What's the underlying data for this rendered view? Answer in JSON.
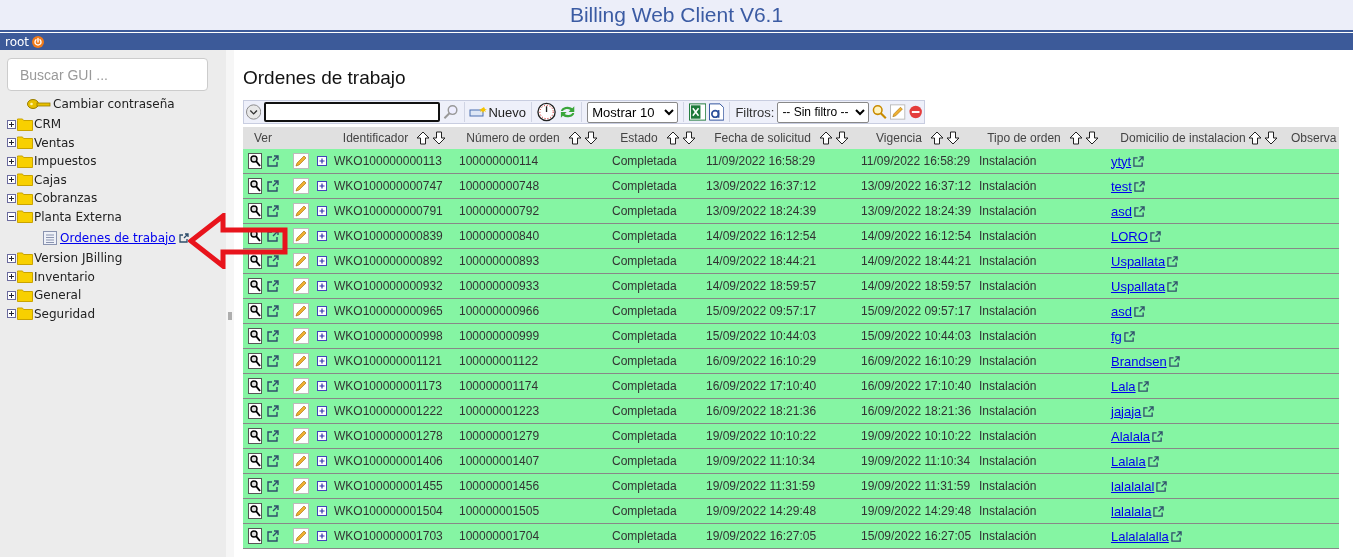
{
  "window": {
    "title": "Billing Web Client V6.1"
  },
  "user_bar": {
    "user": "root"
  },
  "sidebar": {
    "search": {
      "placeholder": "Buscar GUI ..."
    },
    "change_password": "Cambiar contraseña",
    "items": [
      {
        "label": "CRM",
        "expanded": false
      },
      {
        "label": "Ventas",
        "expanded": false
      },
      {
        "label": "Impuestos",
        "expanded": false
      },
      {
        "label": "Cajas",
        "expanded": false
      },
      {
        "label": "Cobranzas",
        "expanded": false
      },
      {
        "label": "Planta Externa",
        "expanded": true,
        "children": [
          {
            "label": "Ordenes de trabajo"
          }
        ]
      },
      {
        "label": "Version JBilling",
        "expanded": false
      },
      {
        "label": "Inventario",
        "expanded": false
      },
      {
        "label": "General",
        "expanded": false
      },
      {
        "label": "Seguridad",
        "expanded": false
      }
    ]
  },
  "page": {
    "heading": "Ordenes de trabajo"
  },
  "toolbar": {
    "new_label": "Nuevo",
    "page_size": "Mostrar 10",
    "filters_label": "Filtros:",
    "filter": "-- Sin filtro --"
  },
  "table": {
    "columns": [
      {
        "label": "Ver",
        "sortable": false
      },
      {
        "label": "Identificador",
        "sortable": true
      },
      {
        "label": "Número de orden",
        "sortable": true
      },
      {
        "label": "Estado",
        "sortable": true
      },
      {
        "label": "Fecha de solicitud",
        "sortable": true
      },
      {
        "label": "Vigencia",
        "sortable": true
      },
      {
        "label": "Tipo de orden",
        "sortable": true
      },
      {
        "label": "Domicilio de instalacion",
        "sortable": true
      },
      {
        "label": "Observa",
        "sortable": false
      }
    ],
    "rows": [
      {
        "id": "WKO100000000113",
        "order": "100000000114",
        "status": "Completada",
        "requested": "11/09/2022 16:58:29",
        "valid": "11/09/2022 16:58:29",
        "type": "Instalación",
        "address": "ytyt"
      },
      {
        "id": "WKO100000000747",
        "order": "100000000748",
        "status": "Completada",
        "requested": "13/09/2022 16:37:12",
        "valid": "13/09/2022 16:37:12",
        "type": "Instalación",
        "address": "test"
      },
      {
        "id": "WKO100000000791",
        "order": "100000000792",
        "status": "Completada",
        "requested": "13/09/2022 18:24:39",
        "valid": "13/09/2022 18:24:39",
        "type": "Instalación",
        "address": "asd"
      },
      {
        "id": "WKO100000000839",
        "order": "100000000840",
        "status": "Completada",
        "requested": "14/09/2022 16:12:54",
        "valid": "14/09/2022 16:12:54",
        "type": "Instalación",
        "address": "LORO"
      },
      {
        "id": "WKO100000000892",
        "order": "100000000893",
        "status": "Completada",
        "requested": "14/09/2022 18:44:21",
        "valid": "14/09/2022 18:44:21",
        "type": "Instalación",
        "address": "Uspallata"
      },
      {
        "id": "WKO100000000932",
        "order": "100000000933",
        "status": "Completada",
        "requested": "14/09/2022 18:59:57",
        "valid": "14/09/2022 18:59:57",
        "type": "Instalación",
        "address": "Uspallata"
      },
      {
        "id": "WKO100000000965",
        "order": "100000000966",
        "status": "Completada",
        "requested": "15/09/2022 09:57:17",
        "valid": "15/09/2022 09:57:17",
        "type": "Instalación",
        "address": "asd"
      },
      {
        "id": "WKO100000000998",
        "order": "100000000999",
        "status": "Completada",
        "requested": "15/09/2022 10:44:03",
        "valid": "15/09/2022 10:44:03",
        "type": "Instalación",
        "address": "fg"
      },
      {
        "id": "WKO100000001121",
        "order": "100000001122",
        "status": "Completada",
        "requested": "16/09/2022 16:10:29",
        "valid": "16/09/2022 16:10:29",
        "type": "Instalación",
        "address": "Brandsen"
      },
      {
        "id": "WKO100000001173",
        "order": "100000001174",
        "status": "Completada",
        "requested": "16/09/2022 17:10:40",
        "valid": "16/09/2022 17:10:40",
        "type": "Instalación",
        "address": "Lala"
      },
      {
        "id": "WKO100000001222",
        "order": "100000001223",
        "status": "Completada",
        "requested": "16/09/2022 18:21:36",
        "valid": "16/09/2022 18:21:36",
        "type": "Instalación",
        "address": "jajaja"
      },
      {
        "id": "WKO100000001278",
        "order": "100000001279",
        "status": "Completada",
        "requested": "19/09/2022 10:10:22",
        "valid": "19/09/2022 10:10:22",
        "type": "Instalación",
        "address": "Alalala"
      },
      {
        "id": "WKO100000001406",
        "order": "100000001407",
        "status": "Completada",
        "requested": "19/09/2022 11:10:34",
        "valid": "19/09/2022 11:10:34",
        "type": "Instalación",
        "address": "Lalala"
      },
      {
        "id": "WKO100000001455",
        "order": "100000001456",
        "status": "Completada",
        "requested": "19/09/2022 11:31:59",
        "valid": "19/09/2022 11:31:59",
        "type": "Instalación",
        "address": "lalalalal"
      },
      {
        "id": "WKO100000001504",
        "order": "100000001505",
        "status": "Completada",
        "requested": "19/09/2022 14:29:48",
        "valid": "19/09/2022 14:29:48",
        "type": "Instalación",
        "address": "lalalala"
      },
      {
        "id": "WKO100000001703",
        "order": "100000001704",
        "status": "Completada",
        "requested": "19/09/2022 16:27:05",
        "valid": "15/09/2022 16:27:05",
        "type": "Instalación",
        "address": "Lalalalalla"
      }
    ]
  }
}
